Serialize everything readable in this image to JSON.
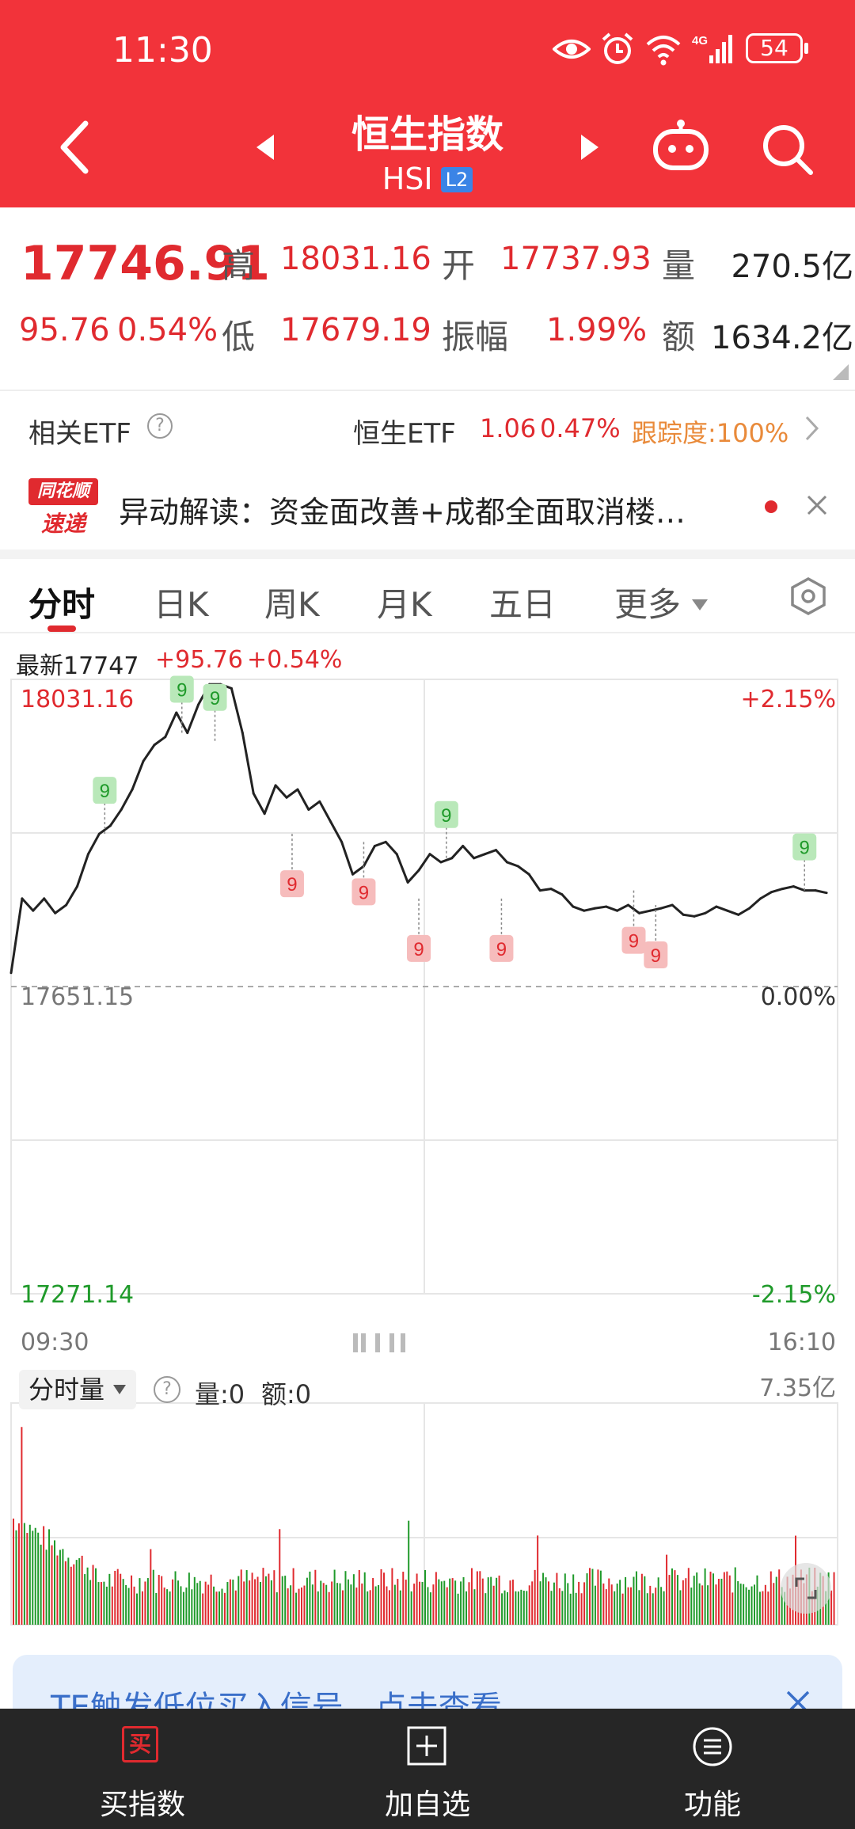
{
  "status": {
    "time": "11:30",
    "battery": "54"
  },
  "header": {
    "title": "恒生指数",
    "code": "HSI",
    "level_badge": "L2"
  },
  "quote": {
    "price": "17746.91",
    "change": "95.76",
    "change_pct": "0.54%",
    "labels": {
      "high": "高",
      "open": "开",
      "volume": "量",
      "low": "低",
      "amplitude": "振幅",
      "amount": "额"
    },
    "high": "18031.16",
    "open": "17737.93",
    "volume": "270.5亿",
    "low": "17679.19",
    "amplitude": "1.99%",
    "amount": "1634.2亿"
  },
  "etf": {
    "label": "相关ETF",
    "name": "恒生ETF",
    "price": "1.06",
    "pct": "0.47%",
    "tracking": "跟踪度:100%"
  },
  "news": {
    "logo_line1": "同花顺",
    "logo_line2": "速递",
    "text": "异动解读：资金面改善+成都全面取消楼…"
  },
  "tabs": [
    {
      "label": "分时"
    },
    {
      "label": "日K"
    },
    {
      "label": "周K"
    },
    {
      "label": "月K"
    },
    {
      "label": "五日"
    },
    {
      "label": "更多"
    }
  ],
  "chart_info": {
    "latest": "最新17747",
    "change": "+95.76",
    "change_pct": "+0.54%"
  },
  "chart_data": {
    "type": "line",
    "y_labels": {
      "top": "18031.16",
      "mid": "17651.15",
      "bottom": "17271.14"
    },
    "pct_labels": {
      "top": "+2.15%",
      "mid": "0.00%",
      "bottom": "-2.15%"
    },
    "x_labels": {
      "start": "09:30",
      "end": "16:10"
    },
    "ylim": [
      17271.14,
      18031.16
    ],
    "prev_close": 17651.15,
    "x_range": [
      0,
      150
    ],
    "series": [
      {
        "x": [
          0,
          2,
          4,
          6,
          8,
          10,
          12,
          14,
          16,
          18,
          20,
          22,
          24,
          26,
          28,
          30,
          32,
          34,
          36,
          38,
          40,
          42,
          44,
          46,
          48,
          50,
          52,
          54,
          56,
          58,
          60,
          62,
          64,
          66,
          68,
          70,
          72,
          74,
          76,
          78,
          80,
          82,
          84,
          86,
          88,
          90,
          92,
          94,
          96,
          98,
          100,
          102,
          104,
          106,
          108,
          110,
          112,
          114,
          116,
          118,
          120,
          122,
          124,
          126,
          128,
          130,
          132,
          134,
          136,
          138,
          140,
          142,
          144,
          146,
          148
        ],
        "y": [
          17668,
          17760,
          17745,
          17760,
          17742,
          17752,
          17775,
          17815,
          17840,
          17850,
          17870,
          17895,
          17930,
          17950,
          17960,
          17990,
          17965,
          18000,
          18025,
          18025,
          18020,
          17965,
          17890,
          17865,
          17900,
          17885,
          17895,
          17870,
          17880,
          17855,
          17830,
          17790,
          17800,
          17825,
          17830,
          17815,
          17780,
          17795,
          17815,
          17805,
          17810,
          17825,
          17810,
          17815,
          17820,
          17805,
          17800,
          17790,
          17770,
          17772,
          17765,
          17750,
          17745,
          17748,
          17750,
          17745,
          17752,
          17742,
          17745,
          17748,
          17752,
          17740,
          17738,
          17742,
          17750,
          17745,
          17740,
          17748,
          17760,
          17768,
          17772,
          17775,
          17770,
          17770,
          17767
        ]
      }
    ],
    "signals": [
      {
        "x": 17,
        "y": 17840,
        "type": "buy",
        "label": "9"
      },
      {
        "x": 31,
        "y": 17965,
        "type": "buy",
        "label": "9"
      },
      {
        "x": 37,
        "y": 17955,
        "type": "buy",
        "label": "9"
      },
      {
        "x": 51,
        "y": 17840,
        "type": "sell",
        "label": "9"
      },
      {
        "x": 64,
        "y": 17830,
        "type": "sell",
        "label": "9"
      },
      {
        "x": 74,
        "y": 17760,
        "type": "sell",
        "label": "9"
      },
      {
        "x": 79,
        "y": 17810,
        "type": "buy",
        "label": "9"
      },
      {
        "x": 89,
        "y": 17760,
        "type": "sell",
        "label": "9"
      },
      {
        "x": 113,
        "y": 17770,
        "type": "sell",
        "label": "9"
      },
      {
        "x": 117,
        "y": 17752,
        "type": "sell",
        "label": "9"
      },
      {
        "x": 144,
        "y": 17770,
        "type": "buy",
        "label": "9"
      }
    ]
  },
  "volume": {
    "selector": "分时量",
    "qty": "量:0",
    "amt": "额:0",
    "max": "7.35亿"
  },
  "banner": {
    "text": "TE触发低位买入信号，点击查看"
  },
  "bottom_nav": [
    {
      "label": "买指数",
      "icon_text": "买"
    },
    {
      "label": "加自选"
    },
    {
      "label": "功能"
    }
  ],
  "colors": {
    "header": "#f2333a",
    "up": "#e02a2f",
    "down": "#1f9a2a",
    "nav": "#262626"
  }
}
